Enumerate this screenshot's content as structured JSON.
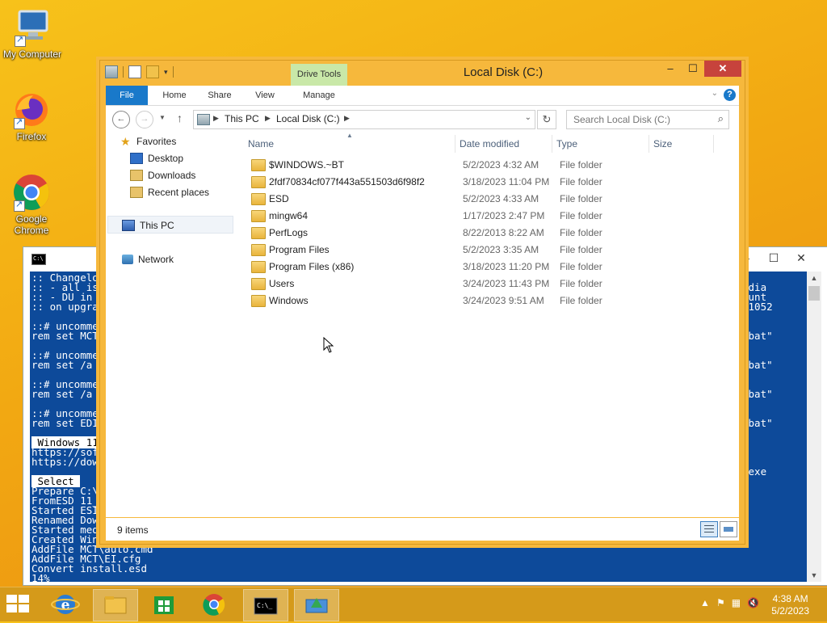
{
  "desktop": {
    "icons": [
      {
        "label": "My Computer"
      },
      {
        "label": "Firefox"
      },
      {
        "label": "Google Chrome"
      }
    ]
  },
  "console": {
    "lines": [
      {
        "text": ":: Changelo",
        "hl": false
      },
      {
        "text": ":: - all is",
        "hl": false
      },
      {
        "text": ":: - DU in",
        "hl": false
      },
      {
        "text": ":: on upgra",
        "hl": false
      },
      {
        "text": "",
        "hl": false
      },
      {
        "text": "::# uncomme",
        "hl": false
      },
      {
        "text": "rem set MCT",
        "hl": false
      },
      {
        "text": "",
        "hl": false
      },
      {
        "text": "::# uncomme",
        "hl": false
      },
      {
        "text": "rem set /a",
        "hl": false
      },
      {
        "text": "",
        "hl": false
      },
      {
        "text": "::# uncomme",
        "hl": false
      },
      {
        "text": "rem set /a",
        "hl": false
      },
      {
        "text": "",
        "hl": false
      },
      {
        "text": "::# uncomme",
        "hl": false
      },
      {
        "text": "rem set EDI",
        "hl": false
      },
      {
        "text": "",
        "hl": false
      },
      {
        "text": " Windows 11",
        "hl": true
      },
      {
        "text": "https://sof",
        "hl": false
      },
      {
        "text": "https://dow",
        "hl": false
      },
      {
        "text": "",
        "hl": false
      },
      {
        "text": " Select ",
        "hl": true
      },
      {
        "text": "Prepare C:\\",
        "hl": false
      },
      {
        "text": "FromESD 11_",
        "hl": false
      },
      {
        "text": "Started ESI",
        "hl": false
      },
      {
        "text": "Renamed Dow",
        "hl": false
      },
      {
        "text": "Started med",
        "hl": false
      },
      {
        "text": "Created Win",
        "hl": false
      },
      {
        "text": "AddFile MCT\\auto.cmd",
        "hl": false
      },
      {
        "text": "AddFile MCT\\EI.cfg",
        "hl": false
      },
      {
        "text": "Convert install.esd",
        "hl": false
      },
      {
        "text": "14%",
        "hl": false
      }
    ],
    "right_lines": [
      "edia",
      "ount",
      "11052",
      "",
      "",
      ".bat\"",
      "",
      "",
      ".bat\"",
      "",
      "",
      ".bat\"",
      "",
      "",
      ".bat\"",
      "",
      "",
      "",
      "",
      ".exe"
    ]
  },
  "explorer": {
    "title": "Local Disk (C:)",
    "contextual_tab": "Drive Tools",
    "ribbon_tabs": [
      "File",
      "Home",
      "Share",
      "View",
      "Manage"
    ],
    "address": {
      "crumbs": [
        "This PC",
        "Local Disk (C:)"
      ]
    },
    "search_placeholder": "Search Local Disk (C:)",
    "nav": {
      "favorites": "Favorites",
      "favorites_items": [
        "Desktop",
        "Downloads",
        "Recent places"
      ],
      "this_pc": "This PC",
      "network": "Network"
    },
    "columns": [
      "Name",
      "Date modified",
      "Type",
      "Size"
    ],
    "files": [
      {
        "name": "$WINDOWS.~BT",
        "date": "5/2/2023 4:32 AM",
        "type": "File folder"
      },
      {
        "name": "2fdf70834cf077f443a551503d6f98f2",
        "date": "3/18/2023 11:04 PM",
        "type": "File folder"
      },
      {
        "name": "ESD",
        "date": "5/2/2023 4:33 AM",
        "type": "File folder"
      },
      {
        "name": "mingw64",
        "date": "1/17/2023 2:47 PM",
        "type": "File folder"
      },
      {
        "name": "PerfLogs",
        "date": "8/22/2013 8:22 AM",
        "type": "File folder"
      },
      {
        "name": "Program Files",
        "date": "5/2/2023 3:35 AM",
        "type": "File folder"
      },
      {
        "name": "Program Files (x86)",
        "date": "3/18/2023 11:20 PM",
        "type": "File folder"
      },
      {
        "name": "Users",
        "date": "3/24/2023 11:43 PM",
        "type": "File folder"
      },
      {
        "name": "Windows",
        "date": "3/24/2023 9:51 AM",
        "type": "File folder"
      }
    ],
    "status": "9 items"
  },
  "taskbar": {
    "time": "4:38 AM",
    "date": "5/2/2023"
  },
  "colors": {
    "accent": "#1979ca",
    "window_frame": "#f6b83c",
    "console_bg": "#0d4a9a",
    "close": "#c7433c"
  }
}
